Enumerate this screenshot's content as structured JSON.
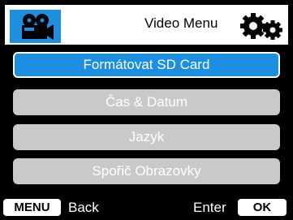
{
  "header": {
    "title": "Video Menu",
    "left_icon": "video-camera-icon",
    "right_icon": "gears-icon"
  },
  "menu": {
    "items": [
      {
        "label": "Formátovat SD Card",
        "selected": true
      },
      {
        "label": "Čas & Datum",
        "selected": false
      },
      {
        "label": "Jazyk",
        "selected": false
      },
      {
        "label": "Spořič Obrazovky",
        "selected": false
      }
    ]
  },
  "footer": {
    "menu_key": "MENU",
    "back_label": "Back",
    "enter_label": "Enter",
    "ok_key": "OK"
  },
  "colors": {
    "accent": "#1d8fe0",
    "item_bg": "#c9c9c9",
    "background": "#000000"
  }
}
